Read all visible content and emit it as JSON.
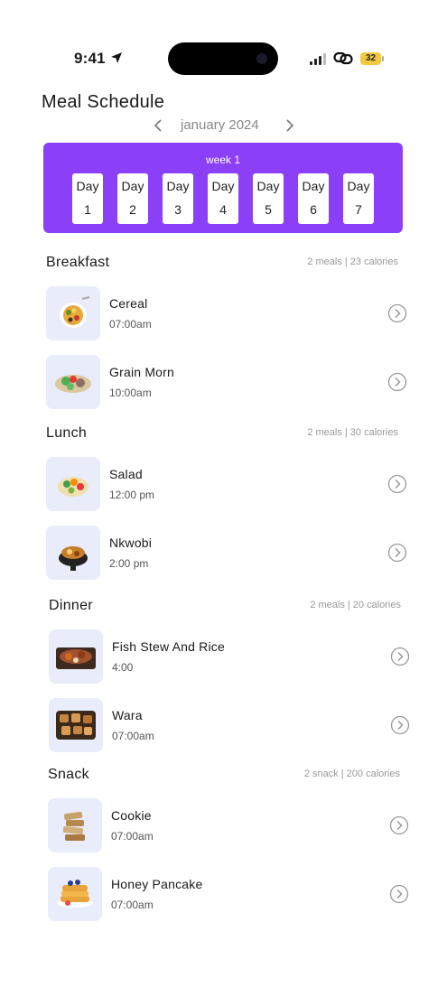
{
  "status": {
    "time": "9:41",
    "battery": "32"
  },
  "header": {
    "title": "Meal Schedule",
    "month": "january 2024"
  },
  "week": {
    "label": "week 1",
    "days": [
      {
        "word": "Day",
        "num": "1"
      },
      {
        "word": "Day",
        "num": "2"
      },
      {
        "word": "Day",
        "num": "3"
      },
      {
        "word": "Day",
        "num": "4"
      },
      {
        "word": "Day",
        "num": "5"
      },
      {
        "word": "Day",
        "num": "6"
      },
      {
        "word": "Day",
        "num": "7"
      }
    ]
  },
  "sections": [
    {
      "title": "Breakfast",
      "meta": "2 meals | 23 calories",
      "meals": [
        {
          "name": "Cereal",
          "time": "07:00am",
          "image": "cereal-bowl"
        },
        {
          "name": "Grain Morn",
          "time": "10:00am",
          "image": "grain-salad"
        }
      ]
    },
    {
      "title": "Lunch",
      "meta": "2 meals | 30 calories",
      "meals": [
        {
          "name": "Salad",
          "time": "12:00 pm",
          "image": "salad-bowl"
        },
        {
          "name": "Nkwobi",
          "time": "2:00 pm",
          "image": "nkwobi-pot"
        }
      ]
    },
    {
      "title": "Dinner",
      "meta": "2 meals | 20 calories",
      "meals": [
        {
          "name": "Fish Stew And Rice",
          "time": "4:00",
          "image": "fish-stew"
        },
        {
          "name": "Wara",
          "time": "07:00am",
          "image": "wara-cheese"
        }
      ]
    },
    {
      "title": "Snack",
      "meta": "2 snack | 200 calories",
      "meals": [
        {
          "name": "Cookie",
          "time": "07:00am",
          "image": "cookie-stack"
        },
        {
          "name": "Honey Pancake",
          "time": "07:00am",
          "image": "pancake-stack"
        }
      ]
    }
  ],
  "colors": {
    "accent": "#8b3ff7",
    "thumb_bg": "#e8ecfb"
  }
}
